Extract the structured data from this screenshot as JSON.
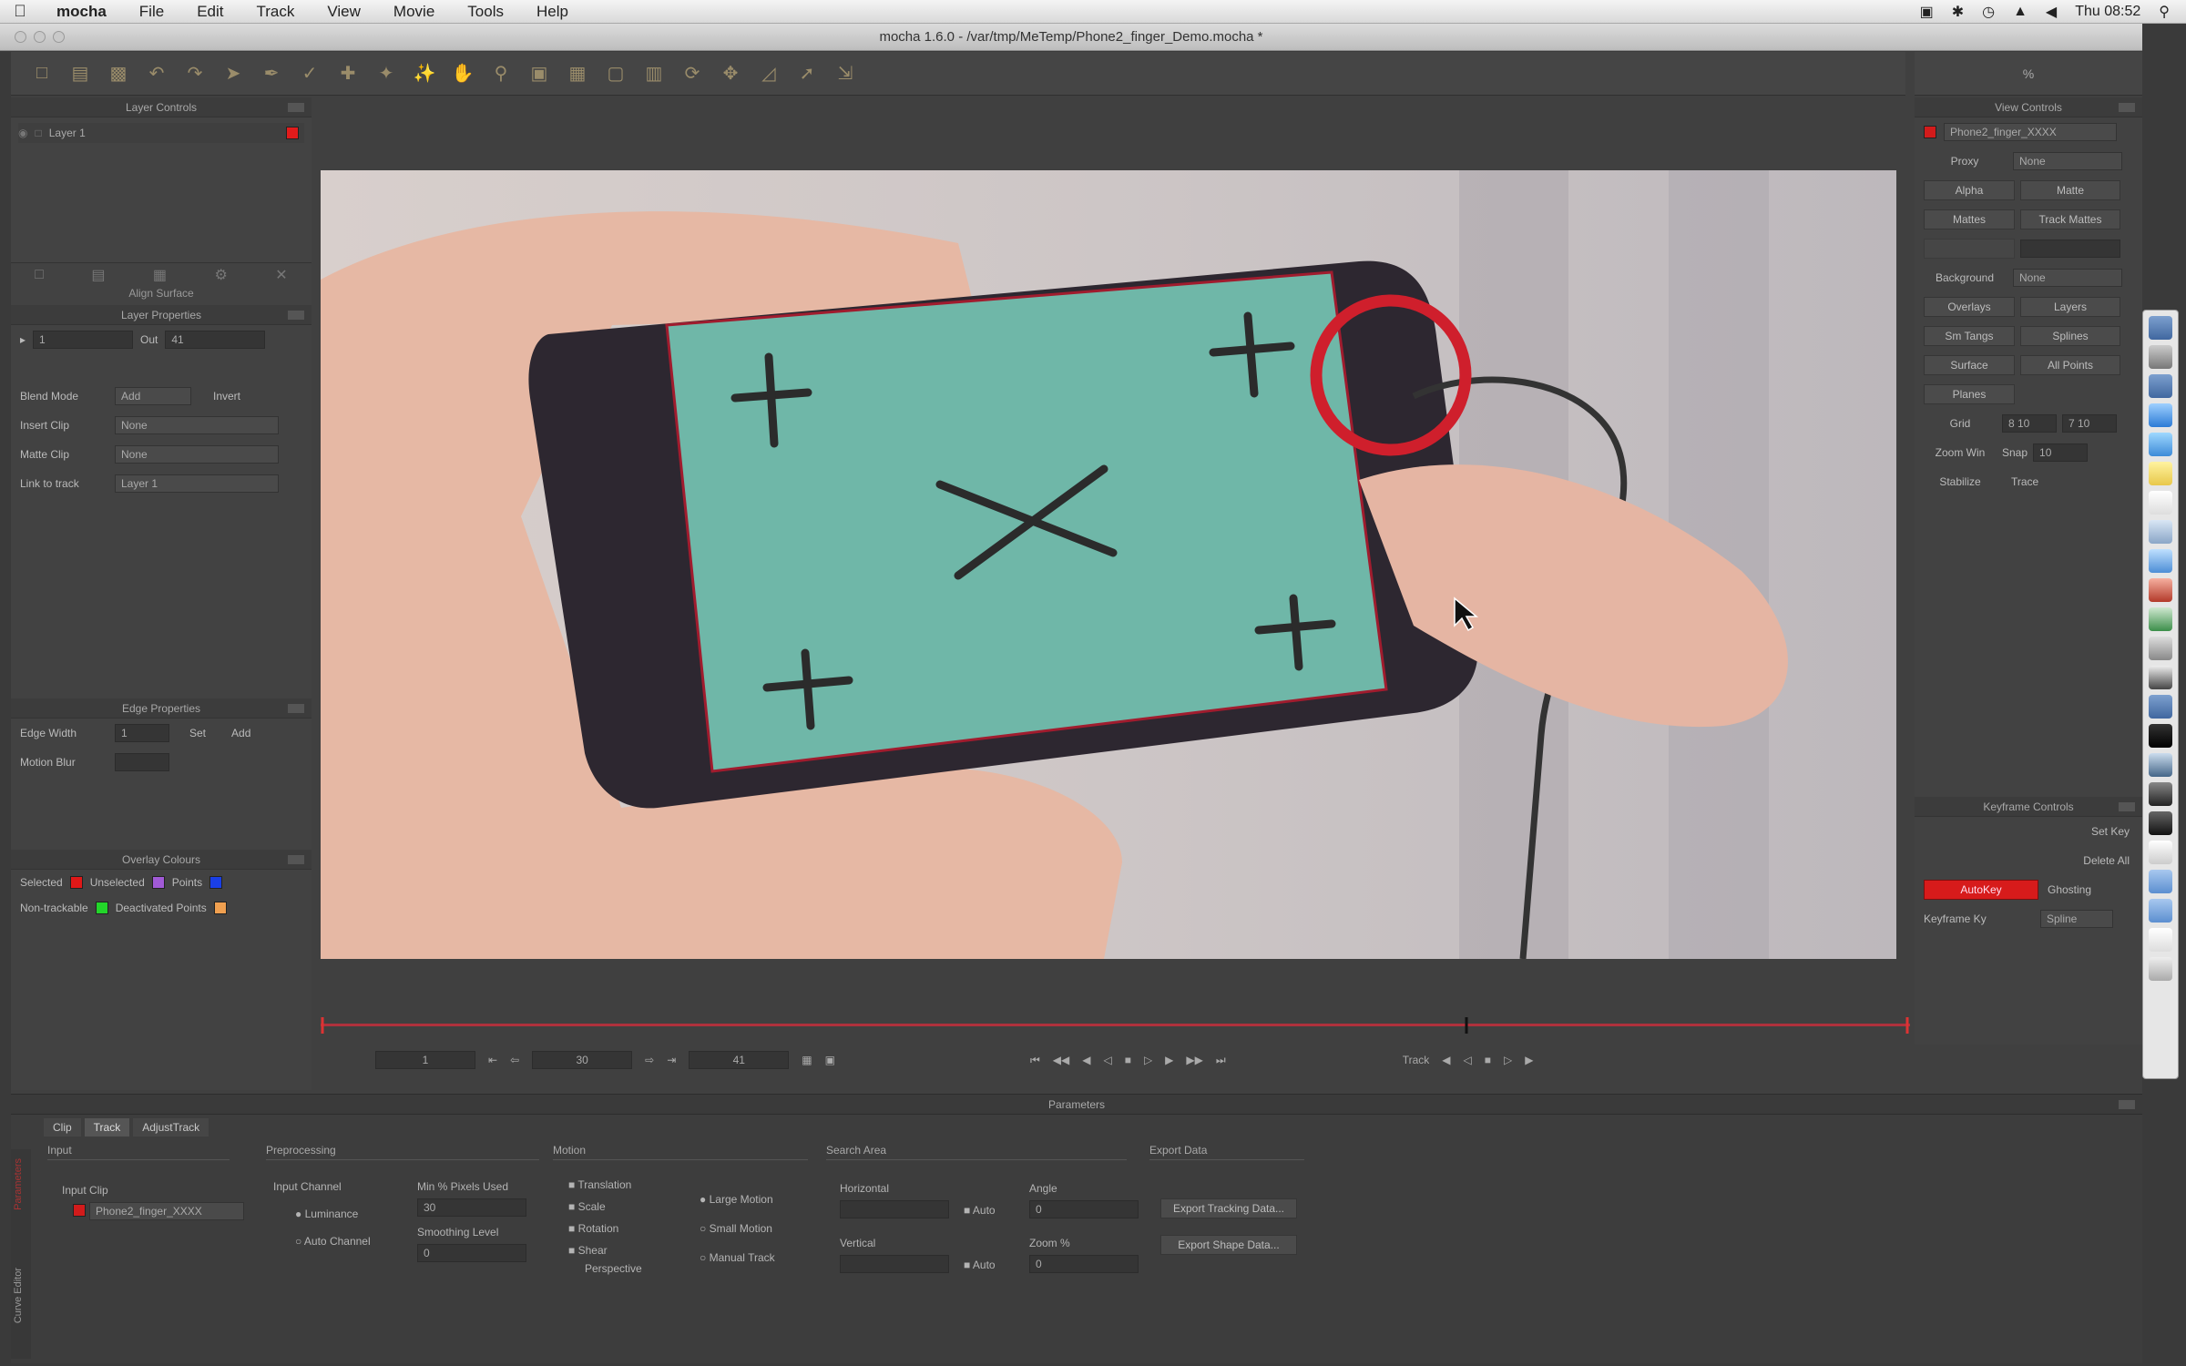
{
  "menubar": {
    "app": "mocha",
    "items": [
      "File",
      "Edit",
      "Track",
      "View",
      "Movie",
      "Tools",
      "Help"
    ],
    "clock": "Thu 08:52"
  },
  "window": {
    "title": "mocha 1.6.0 - /var/tmp/MeTemp/Phone2_finger_Demo.mocha *"
  },
  "layer_controls": {
    "title": "Layer Controls",
    "layer_name": "Layer 1",
    "layer_color": "#e11b1b",
    "align_surface": "Align Surface"
  },
  "layer_properties": {
    "title": "Layer Properties",
    "in_value": "1",
    "out_label": "Out",
    "out_value": "41",
    "blend_mode_label": "Blend Mode",
    "blend_mode_value": "Add",
    "invert_label": "Invert",
    "insert_clip_label": "Insert Clip",
    "insert_clip_value": "None",
    "matte_clip_label": "Matte Clip",
    "matte_clip_value": "None",
    "link_label": "Link to track",
    "link_value": "Layer 1"
  },
  "edge_properties": {
    "title": "Edge Properties",
    "edge_width_label": "Edge Width",
    "edge_width_value": "1",
    "set_label": "Set",
    "add_label": "Add",
    "motion_blur_label": "Motion Blur"
  },
  "overlay_colors": {
    "title": "Overlay Colours",
    "selected": "Selected",
    "unselected": "Unselected",
    "points": "Points",
    "non_trackable": "Non-trackable",
    "deactivated_points": "Deactivated Points",
    "c_selected": "#e01818",
    "c_unselected": "#a15ad6",
    "c_points": "#1a3fe6",
    "c_non_trackable": "#23d52a",
    "c_deactivated": "#f0a050"
  },
  "view_controls": {
    "title": "View Controls",
    "clip_value": "Phone2_finger_XXXX",
    "proxy_label": "Proxy",
    "proxy_value": "None",
    "alpha": "Alpha",
    "matte": "Matte",
    "mattes": "Mattes",
    "track_mattes": "Track Mattes",
    "background_label": "Background",
    "background_value": "None",
    "overlays": "Overlays",
    "layers": "Layers",
    "sm_tangs": "Sm Tangs",
    "splines": "Splines",
    "surface": "Surface",
    "all_points": "All Points",
    "planes": "Planes",
    "grid_label": "Grid",
    "grid_x": "8 10",
    "grid_y": "7 10",
    "zoom_win_label": "Zoom Win",
    "snap_label": "Snap",
    "snap_value": "10",
    "stabilize": "Stabilize",
    "trace": "Trace"
  },
  "keyframe_controls": {
    "title": "Keyframe Controls",
    "set_key": "Set Key",
    "delete_all": "Delete All",
    "autokey": "AutoKey",
    "ghosting": "Ghosting",
    "keyframe_key_label": "Keyframe Ky",
    "keyframe_key_value": "Spline"
  },
  "transport": {
    "in_frame": "1",
    "current_frame": "30",
    "out_frame": "41",
    "track_label": "Track"
  },
  "params": {
    "title": "Parameters",
    "tabs": [
      "Clip",
      "Track",
      "AdjustTrack"
    ],
    "active_tab": "Track",
    "input_head": "Input",
    "input_clip_label": "Input Clip",
    "input_clip_value": "Phone2_finger_XXXX",
    "preprocessing_head": "Preprocessing",
    "input_channel_label": "Input Channel",
    "luminance": "Luminance",
    "auto_channel": "Auto Channel",
    "min_pixels_label": "Min % Pixels Used",
    "min_pixels_value": "30",
    "smoothing_label": "Smoothing Level",
    "smoothing_value": "0",
    "motion_head": "Motion",
    "translation": "Translation",
    "scale": "Scale",
    "rotation": "Rotation",
    "shear": "Shear",
    "perspective": "Perspective",
    "large_motion": "Large Motion",
    "small_motion": "Small Motion",
    "manual_track": "Manual Track",
    "search_area_head": "Search Area",
    "horizontal_label": "Horizontal",
    "vertical_label": "Vertical",
    "auto_label": "Auto",
    "angle_label": "Angle",
    "angle_value": "0",
    "zoom_label": "Zoom %",
    "zoom_value": "0",
    "export_head": "Export Data",
    "export_tracking": "Export Tracking Data...",
    "export_shape": "Export Shape Data..."
  },
  "side_tabs": {
    "params": "Parameters",
    "curve": "Curve Editor"
  }
}
